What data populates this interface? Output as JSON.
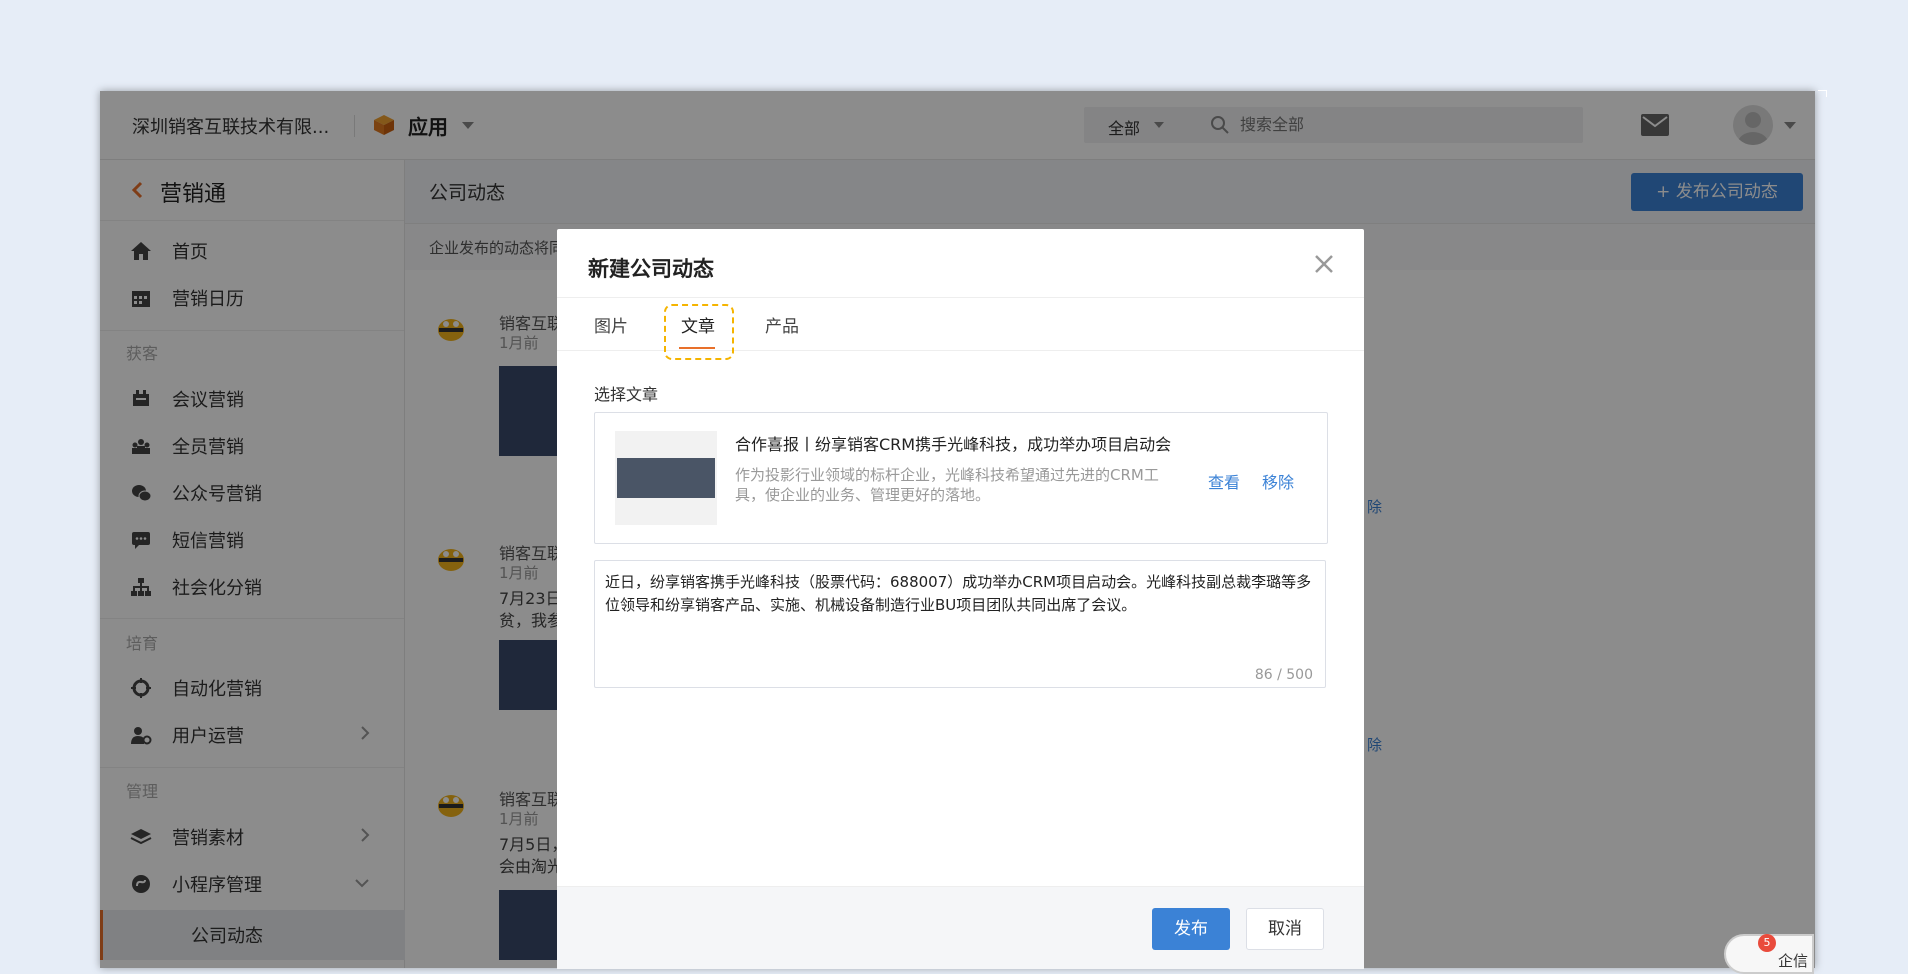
{
  "header": {
    "company": "深圳销客互联技术有限...",
    "app_label": "应用",
    "search_scope": "全部",
    "search_placeholder": "搜索全部"
  },
  "sidebar": {
    "title": "营销通",
    "items_top": [
      {
        "label": "首页",
        "icon": "home-icon"
      },
      {
        "label": "营销日历",
        "icon": "calendar-icon"
      }
    ],
    "section_acquire": "获客",
    "items_acquire": [
      {
        "label": "会议营销",
        "icon": "meeting-icon"
      },
      {
        "label": "全员营销",
        "icon": "team-icon"
      },
      {
        "label": "公众号营销",
        "icon": "wechat-icon"
      },
      {
        "label": "短信营销",
        "icon": "sms-icon"
      },
      {
        "label": "社会化分销",
        "icon": "org-chart-icon"
      }
    ],
    "section_nurture": "培育",
    "items_nurture": [
      {
        "label": "自动化营销",
        "icon": "automation-icon"
      },
      {
        "label": "用户运营",
        "icon": "user-ops-icon"
      }
    ],
    "section_manage": "管理",
    "items_manage": [
      {
        "label": "营销素材",
        "icon": "layers-icon"
      },
      {
        "label": "小程序管理",
        "icon": "miniprogram-icon"
      }
    ],
    "active_sub": "公司动态"
  },
  "main": {
    "page_title": "公司动态",
    "publish_button": "发布公司动态",
    "notice": "企业发布的动态将同",
    "feed": [
      {
        "name": "销客互联",
        "time": "1月前",
        "text": "",
        "delete": "除"
      },
      {
        "name": "销客互联",
        "time": "1月前",
        "text": "7月23日\n贫，我参",
        "delete": "除"
      },
      {
        "name": "销客互联",
        "time": "1月前",
        "text": "7月5日，\n会由淘光",
        "delete": ""
      }
    ]
  },
  "modal": {
    "title": "新建公司动态",
    "tabs": [
      {
        "label": "图片"
      },
      {
        "label": "文章"
      },
      {
        "label": "产品"
      }
    ],
    "active_tab": "文章",
    "section_label": "选择文章",
    "article": {
      "title": "合作喜报丨纷享销客CRM携手光峰科技，成功举办项目启动会",
      "desc": "作为投影行业领域的标杆企业，光峰科技希望通过先进的CRM工具，使企业的业务、管理更好的落地。",
      "view": "查看",
      "remove": "移除"
    },
    "content": "近日，纷享销客携手光峰科技（股票代码：688007）成功举办CRM项目启动会。光峰科技副总裁李璐等多位领导和纷享销客产品、实施、机械设备制造行业BU项目团队共同出席了会议。",
    "counter": "86 / 500",
    "publish": "发布",
    "cancel": "取消"
  },
  "chat": {
    "badge": "5",
    "label": "企信"
  },
  "colors": {
    "accent": "#3b82d6",
    "orange": "#e8702a",
    "highlight": "#f5b400"
  }
}
